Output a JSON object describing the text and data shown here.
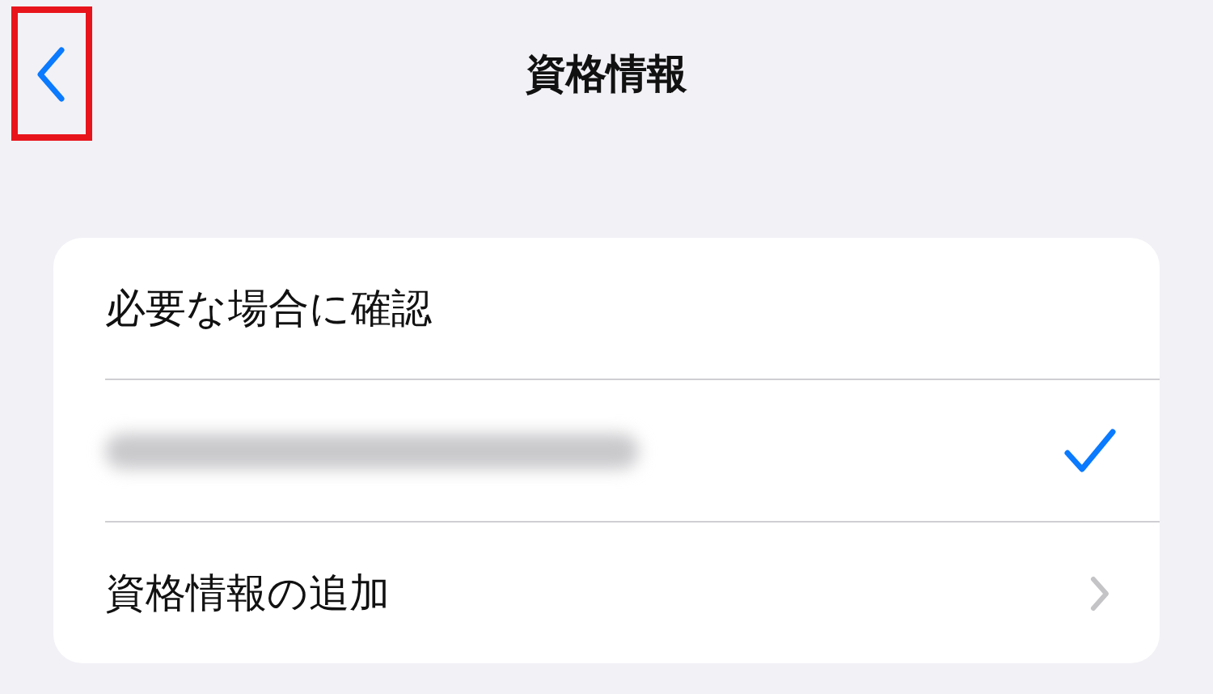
{
  "nav": {
    "title": "資格情報",
    "back_button": {
      "highlighted": true
    }
  },
  "rows": [
    {
      "kind": "text",
      "label": "必要な場合に確認",
      "selected": false
    },
    {
      "kind": "redacted",
      "selected": true
    },
    {
      "kind": "link",
      "label": "資格情報の追加",
      "selected": false
    }
  ]
}
